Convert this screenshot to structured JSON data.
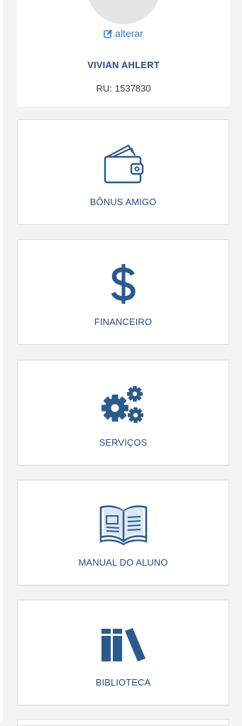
{
  "profile": {
    "edit_label": "alterar",
    "name": "VIVIAN AHLERT",
    "ru_label": "RU:",
    "ru_value": "1537830"
  },
  "cards": [
    {
      "label": "BÔNUS AMIGO",
      "icon": "wallet-icon"
    },
    {
      "label": "FINANCEIRO",
      "icon": "dollar-icon"
    },
    {
      "label": "SERVIÇOS",
      "icon": "gears-icon"
    },
    {
      "label": "MANUAL DO ALUNO",
      "icon": "open-book-icon"
    },
    {
      "label": "BIBLIOTECA",
      "icon": "books-icon"
    }
  ],
  "colors": {
    "icon": "#2c5a8c",
    "label": "#2c4c7f",
    "link": "#3a7bc0",
    "background": "#f3f3f3"
  }
}
